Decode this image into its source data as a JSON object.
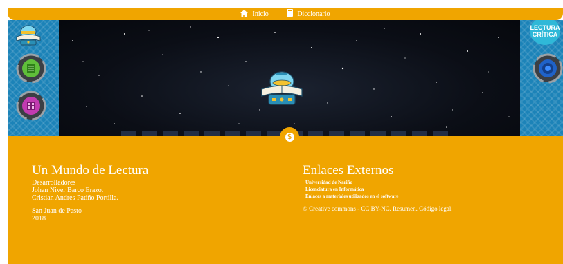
{
  "nav": {
    "home_label": "Inicio",
    "dictionary_label": "Diccionario"
  },
  "side_right": {
    "title_line1": "LECTURA",
    "title_line2": "CRÍTICA"
  },
  "hero": {
    "badge_symbol": "$"
  },
  "footer": {
    "left": {
      "title": "Un Mundo de Lectura",
      "developers_heading": "Desarrolladores",
      "developer_1": "Johan Niver Barco Erazo.",
      "developer_2": "Cristian Andres Patiño Portilla.",
      "city": "San Juan de Pasto",
      "year": "2018"
    },
    "right": {
      "title": "Enlaces Externos",
      "links": [
        "Universidad de Nariño",
        "Licenciatura en Informática",
        "Enlaces a materiales utilizados en el software"
      ],
      "license_prefix": "© Creative commons - CC BY-NC. ",
      "license_summary": "Resumen.",
      "license_legal": "Código legal"
    }
  },
  "colors": {
    "orange": "#f0a500",
    "blue_panel": "#1c83b8",
    "night": "#0b0e16"
  },
  "icons": {
    "home": "home-icon",
    "dictionary": "book-icon",
    "logo": "book-logo-icon",
    "list_button": "list-icon",
    "grid_button": "grid-icon",
    "target_button": "target-icon"
  }
}
